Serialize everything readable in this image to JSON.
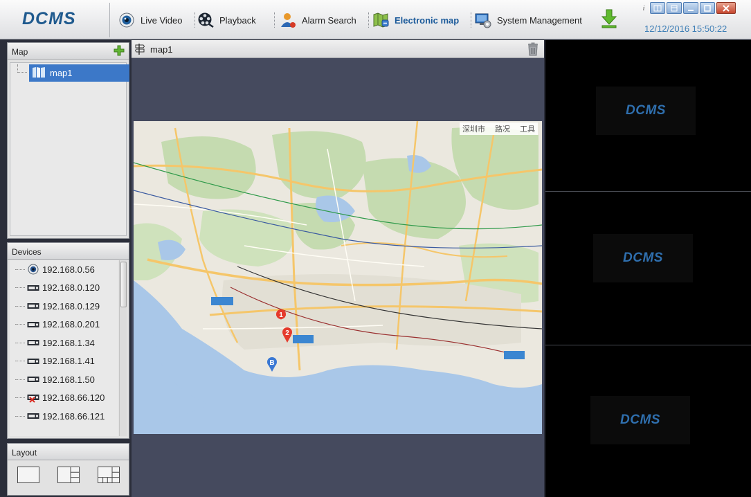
{
  "app": {
    "logo": "DCMS",
    "datetime": "12/12/2016 15:50:22"
  },
  "nav": [
    {
      "label": "Live Video",
      "icon": "eye-icon"
    },
    {
      "label": "Playback",
      "icon": "film-reel-icon"
    },
    {
      "label": "Alarm Search",
      "icon": "user-alarm-icon"
    },
    {
      "label": "Electronic map",
      "icon": "map-icon",
      "active": true
    },
    {
      "label": "System Management",
      "icon": "monitor-gear-icon"
    }
  ],
  "colors": {
    "accent": "#3c78c8",
    "logo": "#1f5a8e",
    "datetime": "#3f7fb6",
    "center_bg": "#454a5e"
  },
  "map_panel": {
    "title": "Map",
    "items": [
      {
        "label": "map1",
        "selected": true
      }
    ]
  },
  "devices_panel": {
    "title": "Devices",
    "items": [
      {
        "label": "192.168.0.56",
        "type": "ipc",
        "status": "online"
      },
      {
        "label": "192.168.0.120",
        "type": "dvr",
        "status": "online"
      },
      {
        "label": "192.168.0.129",
        "type": "dvr",
        "status": "online"
      },
      {
        "label": "192.168.0.201",
        "type": "dvr",
        "status": "online"
      },
      {
        "label": "192.168.1.34",
        "type": "dvr",
        "status": "online"
      },
      {
        "label": "192.168.1.41",
        "type": "dvr",
        "status": "online"
      },
      {
        "label": "192.168.1.50",
        "type": "dvr",
        "status": "online"
      },
      {
        "label": "192.168.66.120",
        "type": "dvr",
        "status": "offline"
      },
      {
        "label": "192.168.66.121",
        "type": "dvr",
        "status": "online"
      }
    ]
  },
  "layout_panel": {
    "title": "Layout",
    "options": [
      "single",
      "two-column",
      "grid"
    ]
  },
  "map_view": {
    "title": "map1",
    "toolbar": [
      "深圳市",
      "路况",
      "工具"
    ],
    "markers": [
      "1",
      "2",
      "B"
    ]
  },
  "video_panes": [
    {
      "watermark": "DCMS"
    },
    {
      "watermark": "DCMS"
    },
    {
      "watermark": "DCMS"
    }
  ]
}
